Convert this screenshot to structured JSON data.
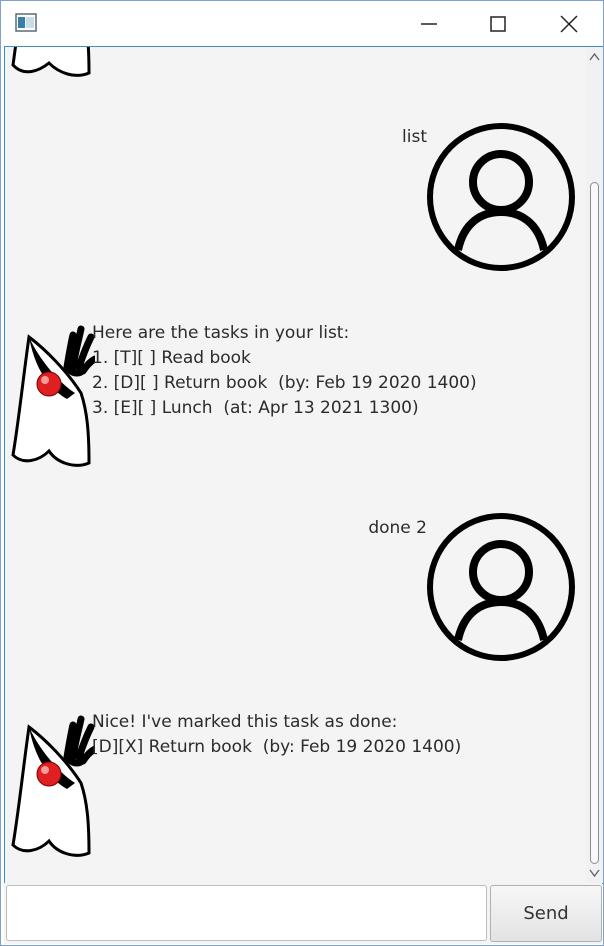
{
  "window": {
    "icon": "app-window-icon",
    "controls": [
      "minimize-icon",
      "maximize-icon",
      "close-icon"
    ]
  },
  "dialog": [
    {
      "speaker": "user",
      "text": "list"
    },
    {
      "speaker": "duke",
      "lines": [
        "Here are the tasks in your list:",
        "1. [T][ ] Read book",
        "2. [D][ ] Return book  (by: Feb 19 2020 1400)",
        "3. [E][ ] Lunch  (at: Apr 13 2021 1300)"
      ]
    },
    {
      "speaker": "user",
      "text": "done 2"
    },
    {
      "speaker": "duke",
      "lines": [
        "Nice! I've marked this task as done:",
        "[D][X] Return book  (by: Feb 19 2020 1400)"
      ]
    }
  ],
  "input": {
    "value": "",
    "placeholder": ""
  },
  "send_label": "Send"
}
